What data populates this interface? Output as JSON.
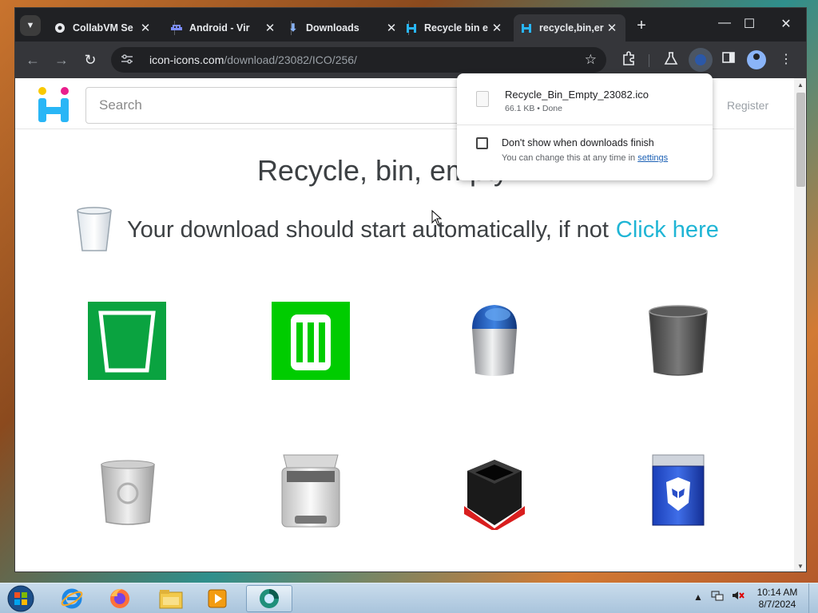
{
  "window": {
    "tabs": [
      {
        "title": "CollabVM Se",
        "close": "✕"
      },
      {
        "title": "Android - Vir",
        "close": "✕"
      },
      {
        "title": "Downloads",
        "close": "✕"
      },
      {
        "title": "Recycle bin e",
        "close": "✕"
      },
      {
        "title": "recycle,bin,er",
        "close": "✕"
      }
    ],
    "new_tab": "+",
    "minimize": "—",
    "maximize": "☐",
    "close": "✕"
  },
  "toolbar": {
    "back": "←",
    "forward": "→",
    "reload": "↻",
    "url_host": "icon-icons.com",
    "url_path": "/download/23082/ICO/256/"
  },
  "site": {
    "search_placeholder": "Search",
    "register": "Register",
    "heading": "Recycle, bin, empty",
    "download_msg": "Your download should start automatically, if not",
    "click_here": "Click here"
  },
  "download_bubble": {
    "file_name": "Recycle_Bin_Empty_23082.ico",
    "file_meta": "66.1 KB • Done",
    "checkbox_label": "Don't show when downloads finish",
    "hint_prefix": "You can change this at any time in",
    "hint_link": "settings"
  },
  "taskbar": {
    "time": "10:14 AM",
    "date": "8/7/2024"
  },
  "colors": {
    "accent_link": "#1fb5d5",
    "tile_green_dark": "#0aa340",
    "tile_green_light": "#00cc00"
  }
}
